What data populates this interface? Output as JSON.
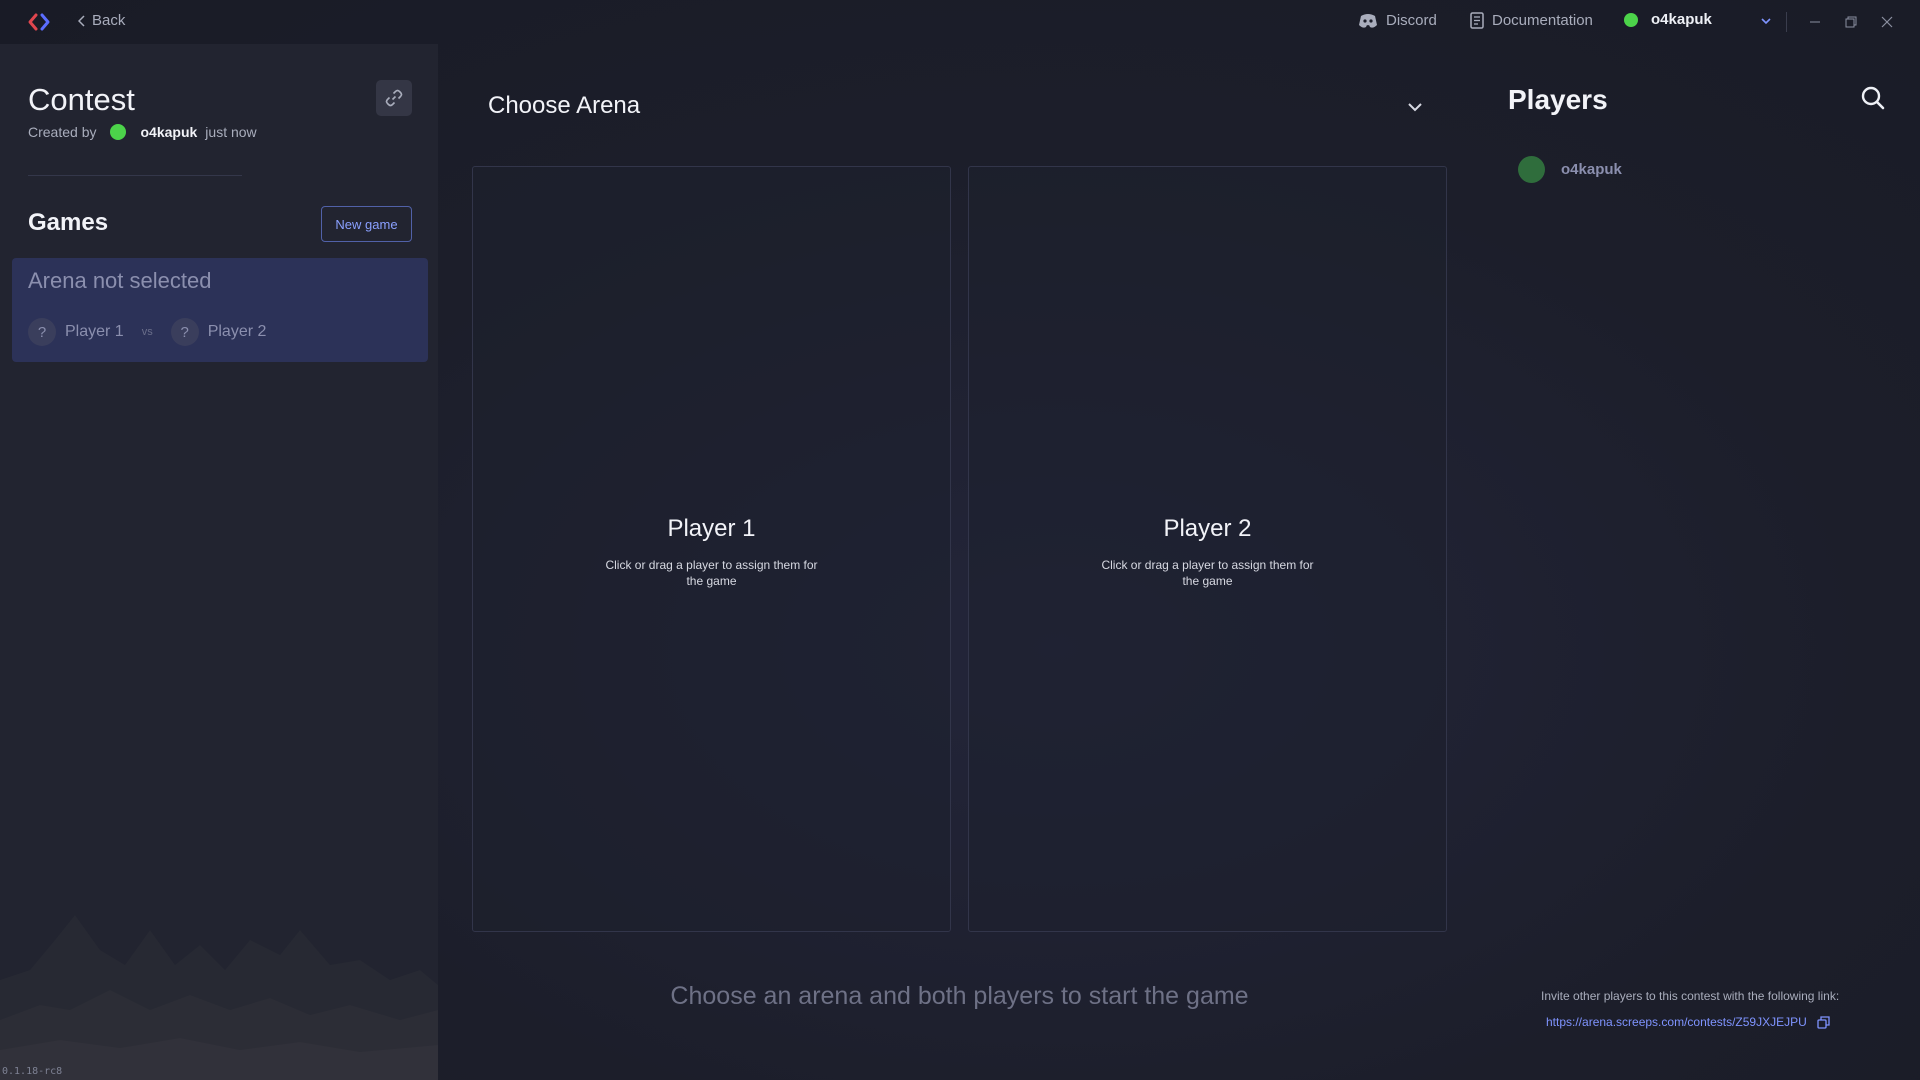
{
  "titlebar": {
    "back_label": "Back",
    "discord_label": "Discord",
    "docs_label": "Documentation",
    "username": "o4kapuk",
    "status_color": "#4cd34a"
  },
  "contest": {
    "title": "Contest",
    "created_by_label": "Created by",
    "author": "o4kapuk",
    "created_time": "just now"
  },
  "games": {
    "title": "Games",
    "new_game_label": "New game",
    "items": [
      {
        "arena": "Arena not selected",
        "player1": "Player 1",
        "vs": "vs",
        "player2": "Player 2",
        "unknown_glyph": "?"
      }
    ]
  },
  "arena": {
    "label": "Choose Arena"
  },
  "slots": [
    {
      "title": "Player 1",
      "hint": "Click or drag a player to assign them for the game"
    },
    {
      "title": "Player 2",
      "hint": "Click or drag a player to assign them for the game"
    }
  ],
  "start_message": "Choose an arena and both players to start the game",
  "players": {
    "title": "Players",
    "list": [
      {
        "name": "o4kapuk"
      }
    ],
    "invite_text": "Invite other players to this contest with the following link:",
    "invite_link": "https://arena.screeps.com/contests/Z59JXJEJPU"
  },
  "version": "0.1.18-rc8",
  "colors": {
    "accent": "#7f94ff",
    "online": "#4cd34a",
    "card": "#2c3258"
  }
}
